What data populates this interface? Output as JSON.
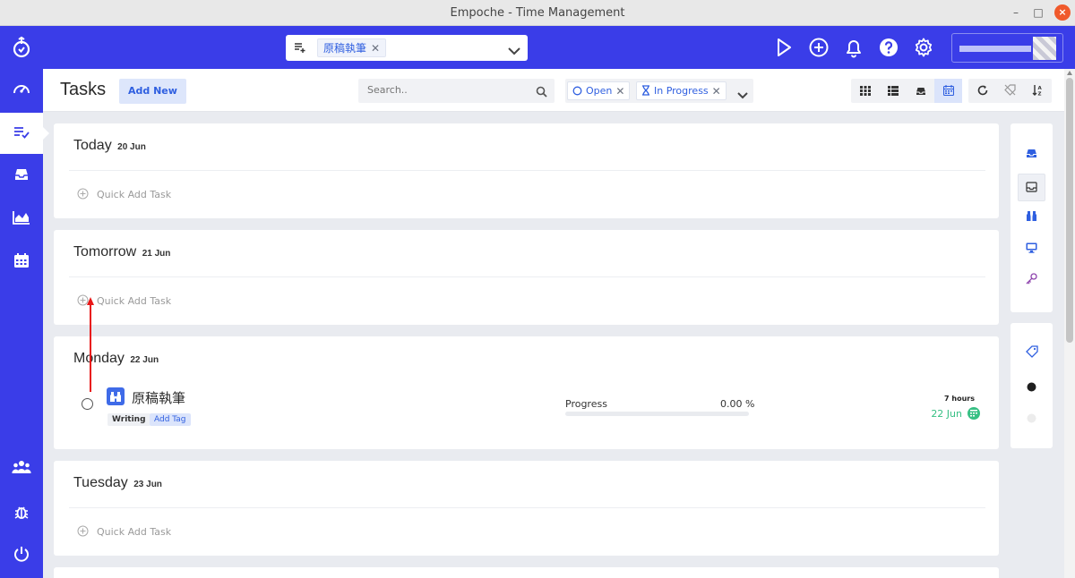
{
  "window": {
    "title": "Empoche - Time Management",
    "controls": [
      "–",
      "□",
      "×"
    ]
  },
  "appbar": {
    "project_select": {
      "selected": "原稿執筆"
    },
    "actions": [
      "play-icon",
      "plus-circle-icon",
      "bell-icon",
      "help-icon",
      "gear-icon"
    ]
  },
  "sidebar": {
    "items": [
      {
        "name": "dashboard",
        "icon": "gauge-icon"
      },
      {
        "name": "tasks",
        "icon": "task-list-icon",
        "active": true
      },
      {
        "name": "inbox",
        "icon": "inbox-icon"
      },
      {
        "name": "reports",
        "icon": "area-chart-icon"
      },
      {
        "name": "calendar",
        "icon": "calendar-icon"
      },
      {
        "name": "team",
        "icon": "users-icon"
      },
      {
        "name": "bug-report",
        "icon": "bug-icon"
      },
      {
        "name": "logout",
        "icon": "power-icon"
      }
    ]
  },
  "toolbar": {
    "title": "Tasks",
    "add_new_label": "Add New",
    "search_placeholder": "Search..",
    "filters": [
      {
        "label": "Open",
        "icon": "circle-icon"
      },
      {
        "label": "In Progress",
        "icon": "hourglass-icon"
      }
    ],
    "views": [
      "grid-icon",
      "list-icon",
      "inbox-icon",
      "calendar-icon"
    ],
    "active_view": "calendar-icon",
    "tools": [
      "refresh-icon",
      "tag-off-icon",
      "sort-icon"
    ]
  },
  "days": [
    {
      "label": "Today",
      "date": "20 Jun",
      "quick_add": "Quick Add Task"
    },
    {
      "label": "Tomorrow",
      "date": "21 Jun",
      "quick_add": "Quick Add Task"
    },
    {
      "label": "Monday",
      "date": "22 Jun",
      "task": {
        "name": "原稿執筆",
        "icon": "binoculars-icon",
        "tags": [
          "Writing"
        ],
        "add_tag_label": "Add Tag",
        "progress_label": "Progress",
        "progress_text": "0.00 %",
        "progress_value": 0,
        "duration": "7 hours",
        "due": "22 Jun"
      }
    },
    {
      "label": "Tuesday",
      "date": "23 Jun",
      "quick_add": "Quick Add Task"
    }
  ],
  "right_rail": {
    "top_icons": [
      "inbox-icon",
      "inbox-filled-icon",
      "binoculars-icon",
      "monitor-icon",
      "key-icon"
    ],
    "active": "inbox-filled-icon",
    "bottom_icons": [
      "tag-icon",
      "dot-dark",
      "dot-light"
    ]
  },
  "colors": {
    "brand": "#3a3de8",
    "accent_blue": "#2f5fe0",
    "due_green": "#37c084",
    "annotation_red": "#e81818"
  }
}
